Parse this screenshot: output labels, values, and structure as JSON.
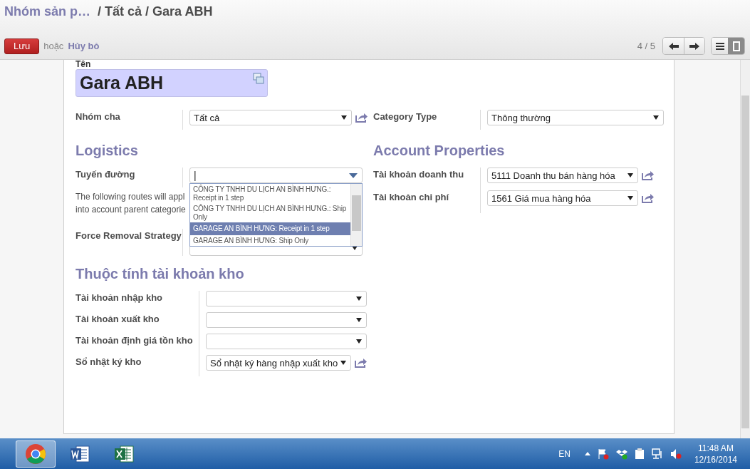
{
  "breadcrumb": {
    "parent": "Nhóm sản p…",
    "current": "/ Tất cả / Gara ABH"
  },
  "actions": {
    "save": "Lưu",
    "or": "hoặc",
    "discard": "Hủy bỏ"
  },
  "pager": {
    "counter": "4 / 5"
  },
  "view_switch": [
    {
      "kind": "list",
      "selected": false
    },
    {
      "kind": "form",
      "selected": true
    }
  ],
  "form": {
    "name_label": "Tên",
    "name": "Gara ABH",
    "top_fields": [
      {
        "label": "Nhóm cha",
        "value": "Tất cả",
        "external_link": true
      },
      {
        "label": "Category Type",
        "value": "Thông thường",
        "external_link": false
      }
    ],
    "logistics": {
      "title": "Logistics",
      "routes_label": "Tuyến đường",
      "routes_value": "|",
      "note_lines": [
        "The following routes will appl",
        "into account parent categorie"
      ],
      "removal_label": "Force Removal Strategy",
      "route_options": [
        {
          "text": "CÔNG TY TNHH DU LỊCH AN BÌNH HƯNG.: Receipt in 1 step",
          "selected": false
        },
        {
          "text": "CÔNG TY TNHH DU LỊCH AN BÌNH HƯNG.: Ship Only",
          "selected": false
        },
        {
          "text": "GARAGE AN BÌNH HƯNG: Receipt in 1 step",
          "selected": true
        },
        {
          "text": "GARAGE AN BÌNH HƯNG: Ship Only",
          "selected": false
        }
      ]
    },
    "account": {
      "title": "Account Properties",
      "fields": [
        {
          "label": "Tài khoản doanh thu",
          "value": "5111 Doanh thu bán hàng hóa",
          "external_link": true
        },
        {
          "label": "Tài khoản chi phí",
          "value": "1561 Giá mua hàng hóa",
          "external_link": true
        }
      ]
    },
    "stock": {
      "title": "Thuộc tính tài khoản kho",
      "fields": [
        {
          "label": "Tài khoản nhập kho",
          "external_link": false
        },
        {
          "label": "Tài khoản xuất kho",
          "external_link": false
        },
        {
          "label": "Tài khoản định giá tồn kho",
          "external_link": false
        },
        {
          "label": "Sổ nhật ký kho",
          "value": "Sổ nhật ký hàng nhập xuất kho",
          "external_link": true
        }
      ]
    }
  },
  "taskbar": {
    "apps": [
      {
        "kind": "chrome",
        "selected": true
      },
      {
        "kind": "word",
        "selected": false
      },
      {
        "kind": "excel",
        "selected": false
      }
    ],
    "language": "EN",
    "time": "11:48 AM",
    "date": "12/16/2014"
  }
}
